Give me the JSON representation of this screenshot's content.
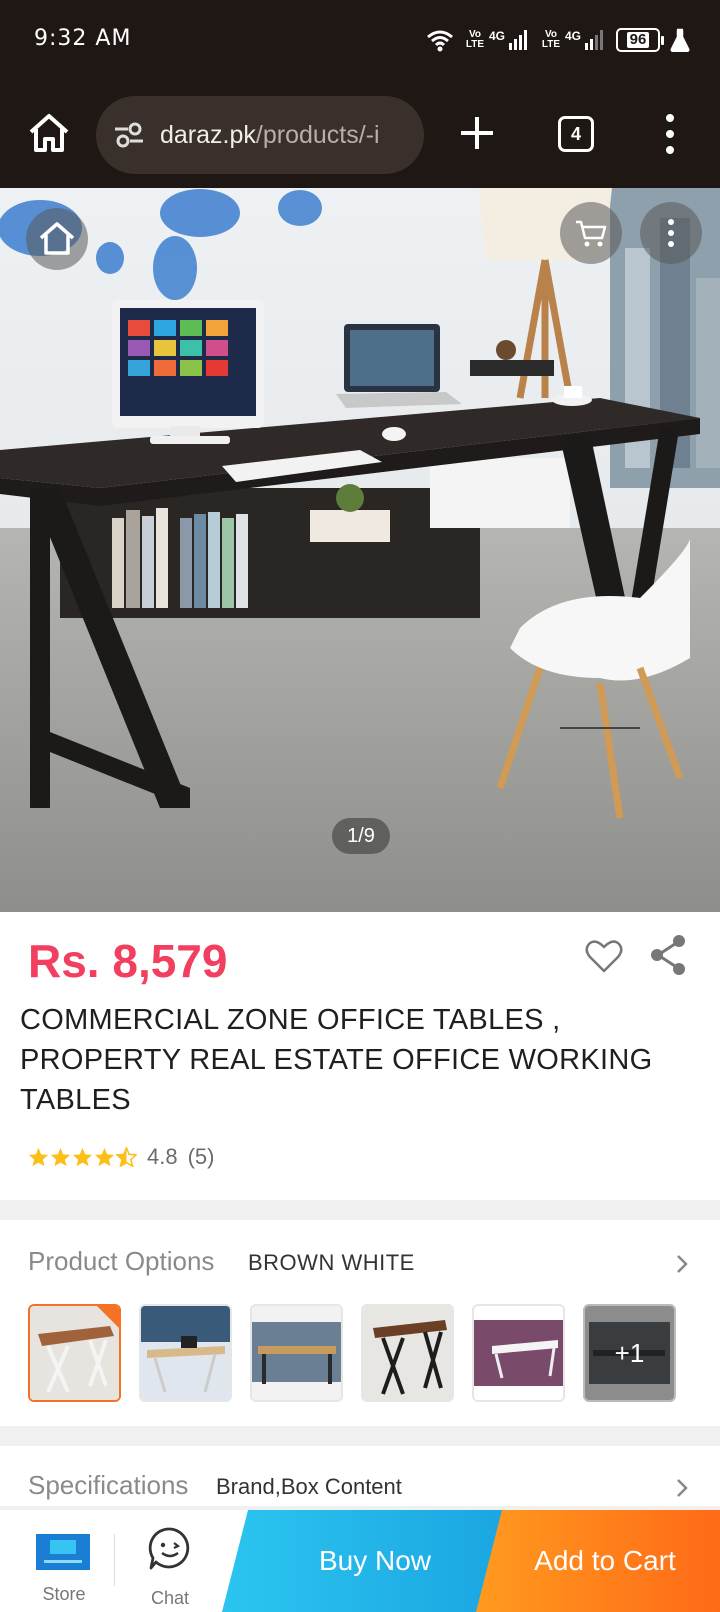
{
  "status_bar": {
    "time": "9:32 AM",
    "sim1_tag": "Vo LTE",
    "sim1_network": "4G",
    "sim2_tag": "Vo LTE",
    "sim2_network": "4G",
    "battery": "96",
    "icons": [
      "wifi-icon",
      "signal-icon",
      "battery-icon",
      "flask-icon"
    ]
  },
  "browser": {
    "url_host": "daraz.pk",
    "url_path": "/products/-i",
    "tab_count": "4",
    "icons": [
      "home-icon",
      "site-settings-icon",
      "plus-icon",
      "tabs-icon",
      "more-vert-icon"
    ]
  },
  "gallery": {
    "counter": "1/9",
    "icons": [
      "home-icon",
      "cart-icon",
      "more-vert-icon"
    ]
  },
  "product": {
    "price": "Rs. 8,579",
    "title": "COMMERCIAL ZONE OFFICE TABLES , PROPERTY REAL ESTATE OFFICE WORKING TABLES",
    "rating": "4.8",
    "rating_count": "(5)",
    "stars": 4.8,
    "icons": [
      "heart-icon",
      "share-icon",
      "star-icon"
    ]
  },
  "options": {
    "label": "Product Options",
    "value": "BROWN WHITE",
    "more_count": "+1",
    "thumbnail_count": 6
  },
  "specifications": {
    "label": "Specifications",
    "value": "Brand,Box Content"
  },
  "actions": {
    "store_label": "Store",
    "chat_label": "Chat",
    "buy_now": "Buy Now",
    "add_to_cart": "Add to Cart"
  },
  "colors": {
    "price": "#f23f5f",
    "buy_now": "#1aa3e0",
    "add_to_cart": "#ff6a17",
    "chrome": "#1e1714"
  }
}
